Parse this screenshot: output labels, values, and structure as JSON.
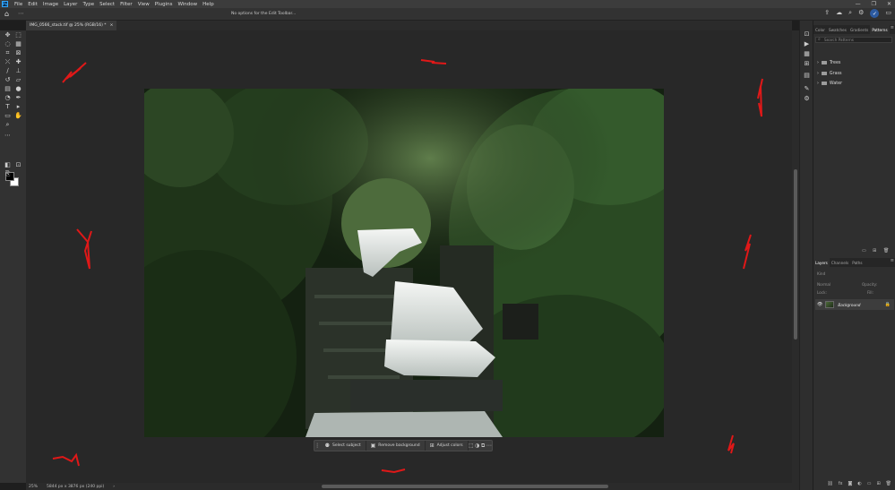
{
  "app": {
    "logo": "Ps",
    "menu": [
      "File",
      "Edit",
      "Image",
      "Layer",
      "Type",
      "Select",
      "Filter",
      "View",
      "Plugins",
      "Window",
      "Help"
    ],
    "window_controls": [
      "—",
      "❐",
      "✕"
    ]
  },
  "options_bar": {
    "message": "No options for the Edit Toolbar..."
  },
  "document": {
    "tab_title": "IMG_0566_stack.tif @ 25% (RGB/16) *",
    "tab_close": "×",
    "zoom": "25%",
    "dimensions": "5844 px x 3876 px (240 ppi)"
  },
  "taskbar": {
    "select_subject": "Select subject",
    "remove_background": "Remove background",
    "adjust_colors": "Adjust colors"
  },
  "panels": {
    "top_tabs": [
      "Color",
      "Swatches",
      "Gradients",
      "Patterns"
    ],
    "active_top_tab": "Patterns",
    "search_placeholder": "Search Patterns",
    "pattern_folders": [
      "Trees",
      "Grass",
      "Water"
    ],
    "layer_tabs": [
      "Layers",
      "Channels",
      "Paths"
    ],
    "kind_label": "Kind",
    "blend_mode": "Normal",
    "opacity_label": "Opacity:",
    "lock_label": "Lock:",
    "fill_label": "Fill:",
    "layer_name": "Background"
  },
  "colors": {
    "accent": "#31a8ff",
    "annotation_red": "#e01818"
  }
}
